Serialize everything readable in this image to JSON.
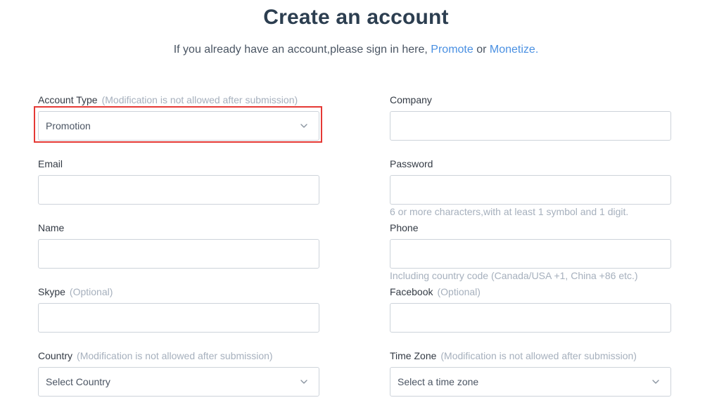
{
  "header": {
    "title": "Create an account",
    "subtitle_prefix": "If you already have an account,please sign in here,",
    "link_promote": "Promote",
    "subtitle_or": "or",
    "link_monetize": "Monetize",
    "subtitle_suffix": "."
  },
  "form": {
    "account_type": {
      "label": "Account Type",
      "note": "(Modification is not allowed after submission)",
      "value": "Promotion"
    },
    "company": {
      "label": "Company",
      "value": ""
    },
    "email": {
      "label": "Email",
      "value": ""
    },
    "password": {
      "label": "Password",
      "value": "",
      "hint": "6 or more characters,with at least 1 symbol and 1 digit."
    },
    "name": {
      "label": "Name",
      "value": ""
    },
    "phone": {
      "label": "Phone",
      "value": "",
      "hint": "Including country code (Canada/USA +1, China +86 etc.)"
    },
    "skype": {
      "label": "Skype",
      "note": "(Optional)",
      "value": ""
    },
    "facebook": {
      "label": "Facebook",
      "note": "(Optional)",
      "value": ""
    },
    "country": {
      "label": "Country",
      "note": "(Modification is not allowed after submission)",
      "value": "Select Country"
    },
    "time_zone": {
      "label": "Time Zone",
      "note": "(Modification is not allowed after submission)",
      "value": "Select a time zone"
    }
  },
  "colors": {
    "title": "#2c3e50",
    "link": "#4a90e2",
    "muted": "#a6b0bd",
    "border": "#cdd3da",
    "highlight": "#e53935"
  },
  "icons": {
    "select_arrow": "chevron-down-icon"
  }
}
